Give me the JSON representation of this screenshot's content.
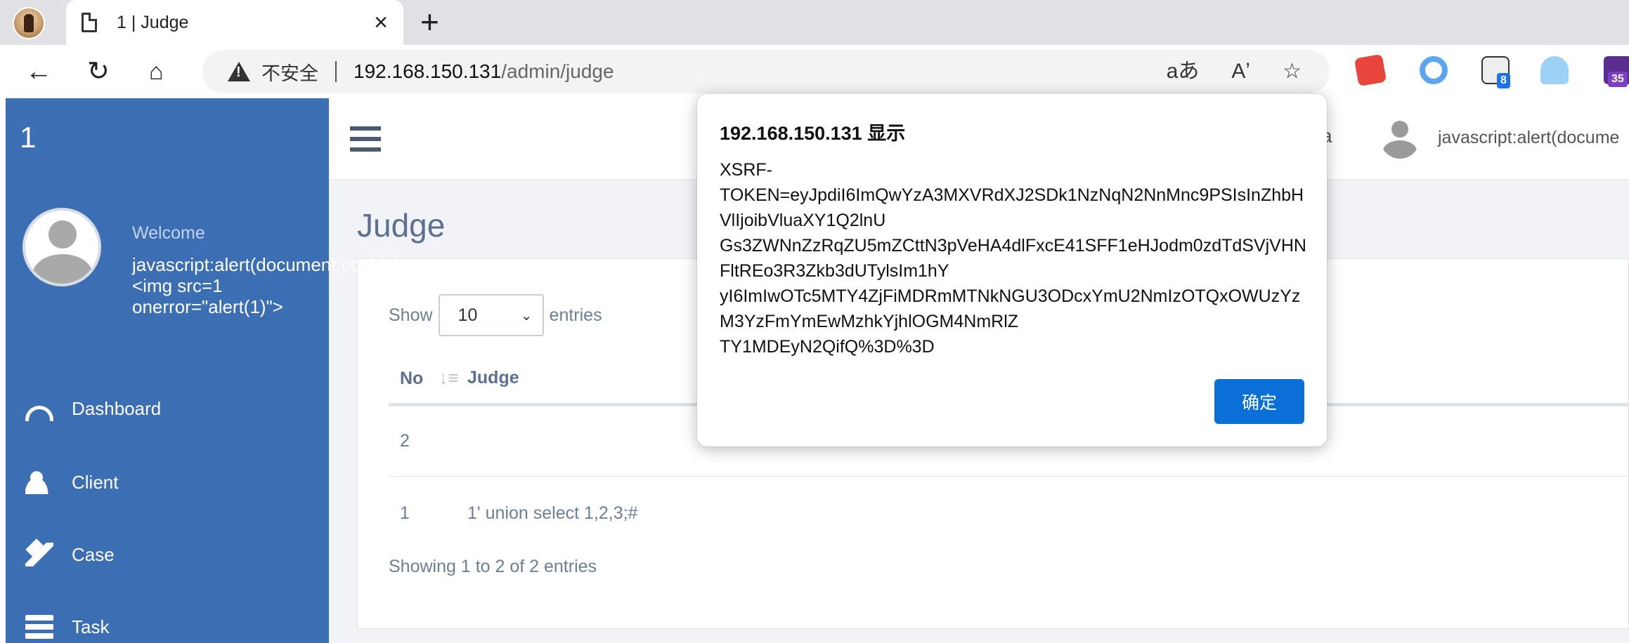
{
  "browser": {
    "tab_title": "1 | Judge",
    "tab_close": "×",
    "new_tab": "+",
    "address": {
      "security_label": "不安全",
      "host": "192.168.150.131",
      "path": "/admin/judge"
    },
    "icons": {
      "back": "back-arrow-icon",
      "reload": "reload-icon",
      "home": "home-icon",
      "translate": "aあ",
      "read_aloud": "Aʼ",
      "favorite": "☆"
    },
    "extension_badges": [
      "8",
      "35"
    ]
  },
  "sidebar": {
    "brand": "1",
    "welcome": "Welcome",
    "username_lines": [
      "javascript:alert(document.cookie)",
      "<img src=1",
      "onerror=\"alert(1)\">"
    ],
    "menu": [
      {
        "label": "Dashboard",
        "icon": "dashboard-icon"
      },
      {
        "label": "Client",
        "icon": "add-user-icon"
      },
      {
        "label": "Case",
        "icon": "gavel-icon"
      },
      {
        "label": "Task",
        "icon": "task-list-icon"
      }
    ]
  },
  "topbar": {
    "lang_glyph": "a",
    "user": "javascript:alert(docume"
  },
  "page": {
    "title": "Judge",
    "show_label": "Show",
    "entries_label": "entries",
    "page_length": "10",
    "columns": [
      "No",
      "Judge"
    ],
    "rows": [
      {
        "no": "2",
        "judge": ""
      },
      {
        "no": "1",
        "judge": "1' union select 1,2,3;#"
      }
    ],
    "info": "Showing 1 to 2 of 2 entries"
  },
  "dialog": {
    "title": "192.168.150.131 显示",
    "message_lines": [
      "XSRF-",
      "TOKEN=eyJpdiI6ImQwYzA3MXVRdXJ2SDk1NzNqN2NnMnc9PSIsInZhbH",
      "VlIjoibVluaXY1Q2lnU",
      "Gs3ZWNnZzRqZU5mZCttN3pVeHA4dlFxcE41SFF1eHJodm0zdTdSVjVHN",
      "FltREo3R3Zkb3dUTylsIm1hY",
      "yI6ImIwOTc5MTY4ZjFiMDRmMTNkNGU3ODcxYmU2NmIzOTQxOWUzYz",
      "M3YzFmYmEwMzhkYjhlOGM4NmRlZ",
      "TY1MDEyN2QifQ%3D%3D"
    ],
    "ok_label": "确定"
  }
}
